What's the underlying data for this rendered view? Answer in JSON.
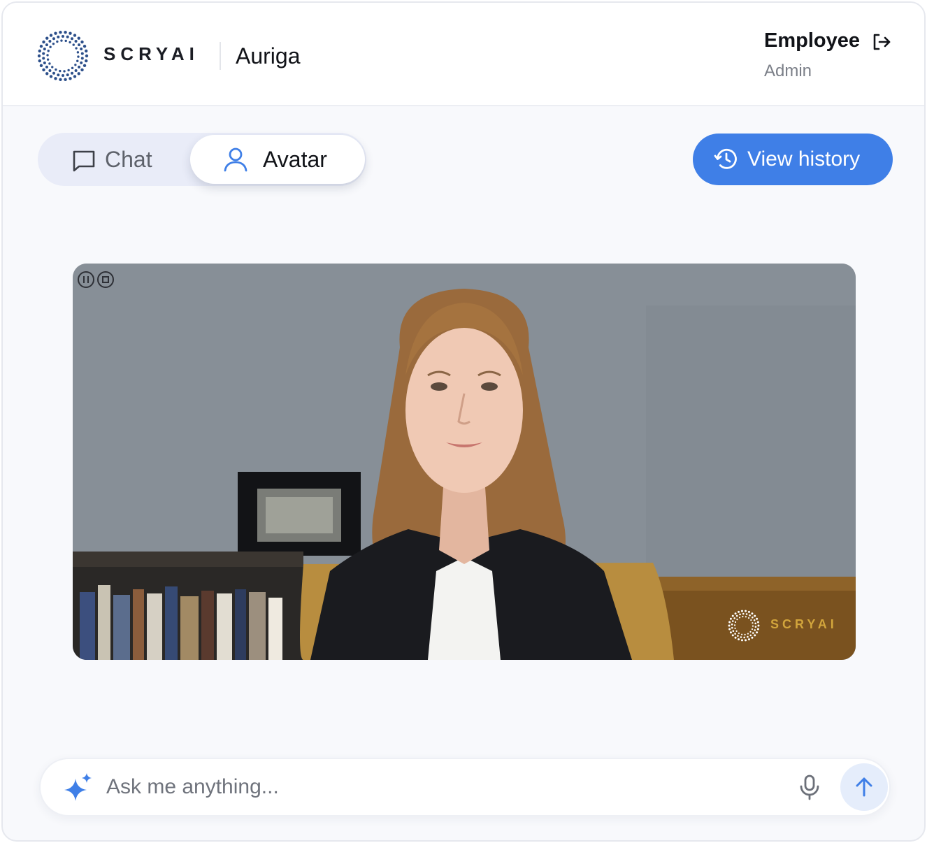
{
  "brand": {
    "logo_text": "SCRYAI",
    "product_name": "Auriga",
    "logo_icon": "dotted-circle-logo"
  },
  "user": {
    "name": "Employee",
    "role": "Admin",
    "logout_icon": "logout-icon"
  },
  "mode_tabs": [
    {
      "label": "Chat",
      "icon": "chat-bubble-icon",
      "active": false
    },
    {
      "label": "Avatar",
      "icon": "person-icon",
      "active": true
    }
  ],
  "history_button": {
    "label": "View history",
    "icon": "history-icon"
  },
  "video": {
    "controls": [
      "pause-icon",
      "stop-icon"
    ],
    "watermark_text": "SCRYAI"
  },
  "input": {
    "placeholder": "Ask me anything...",
    "value": "",
    "icons": [
      "sparkle-icon",
      "microphone-icon",
      "arrow-up-icon"
    ]
  },
  "colors": {
    "accent": "#3f7fe7",
    "toggle_bg": "#e9ecf8",
    "logo_blue": "#2c4f8a",
    "watermark_gold": "#d2a53c"
  }
}
